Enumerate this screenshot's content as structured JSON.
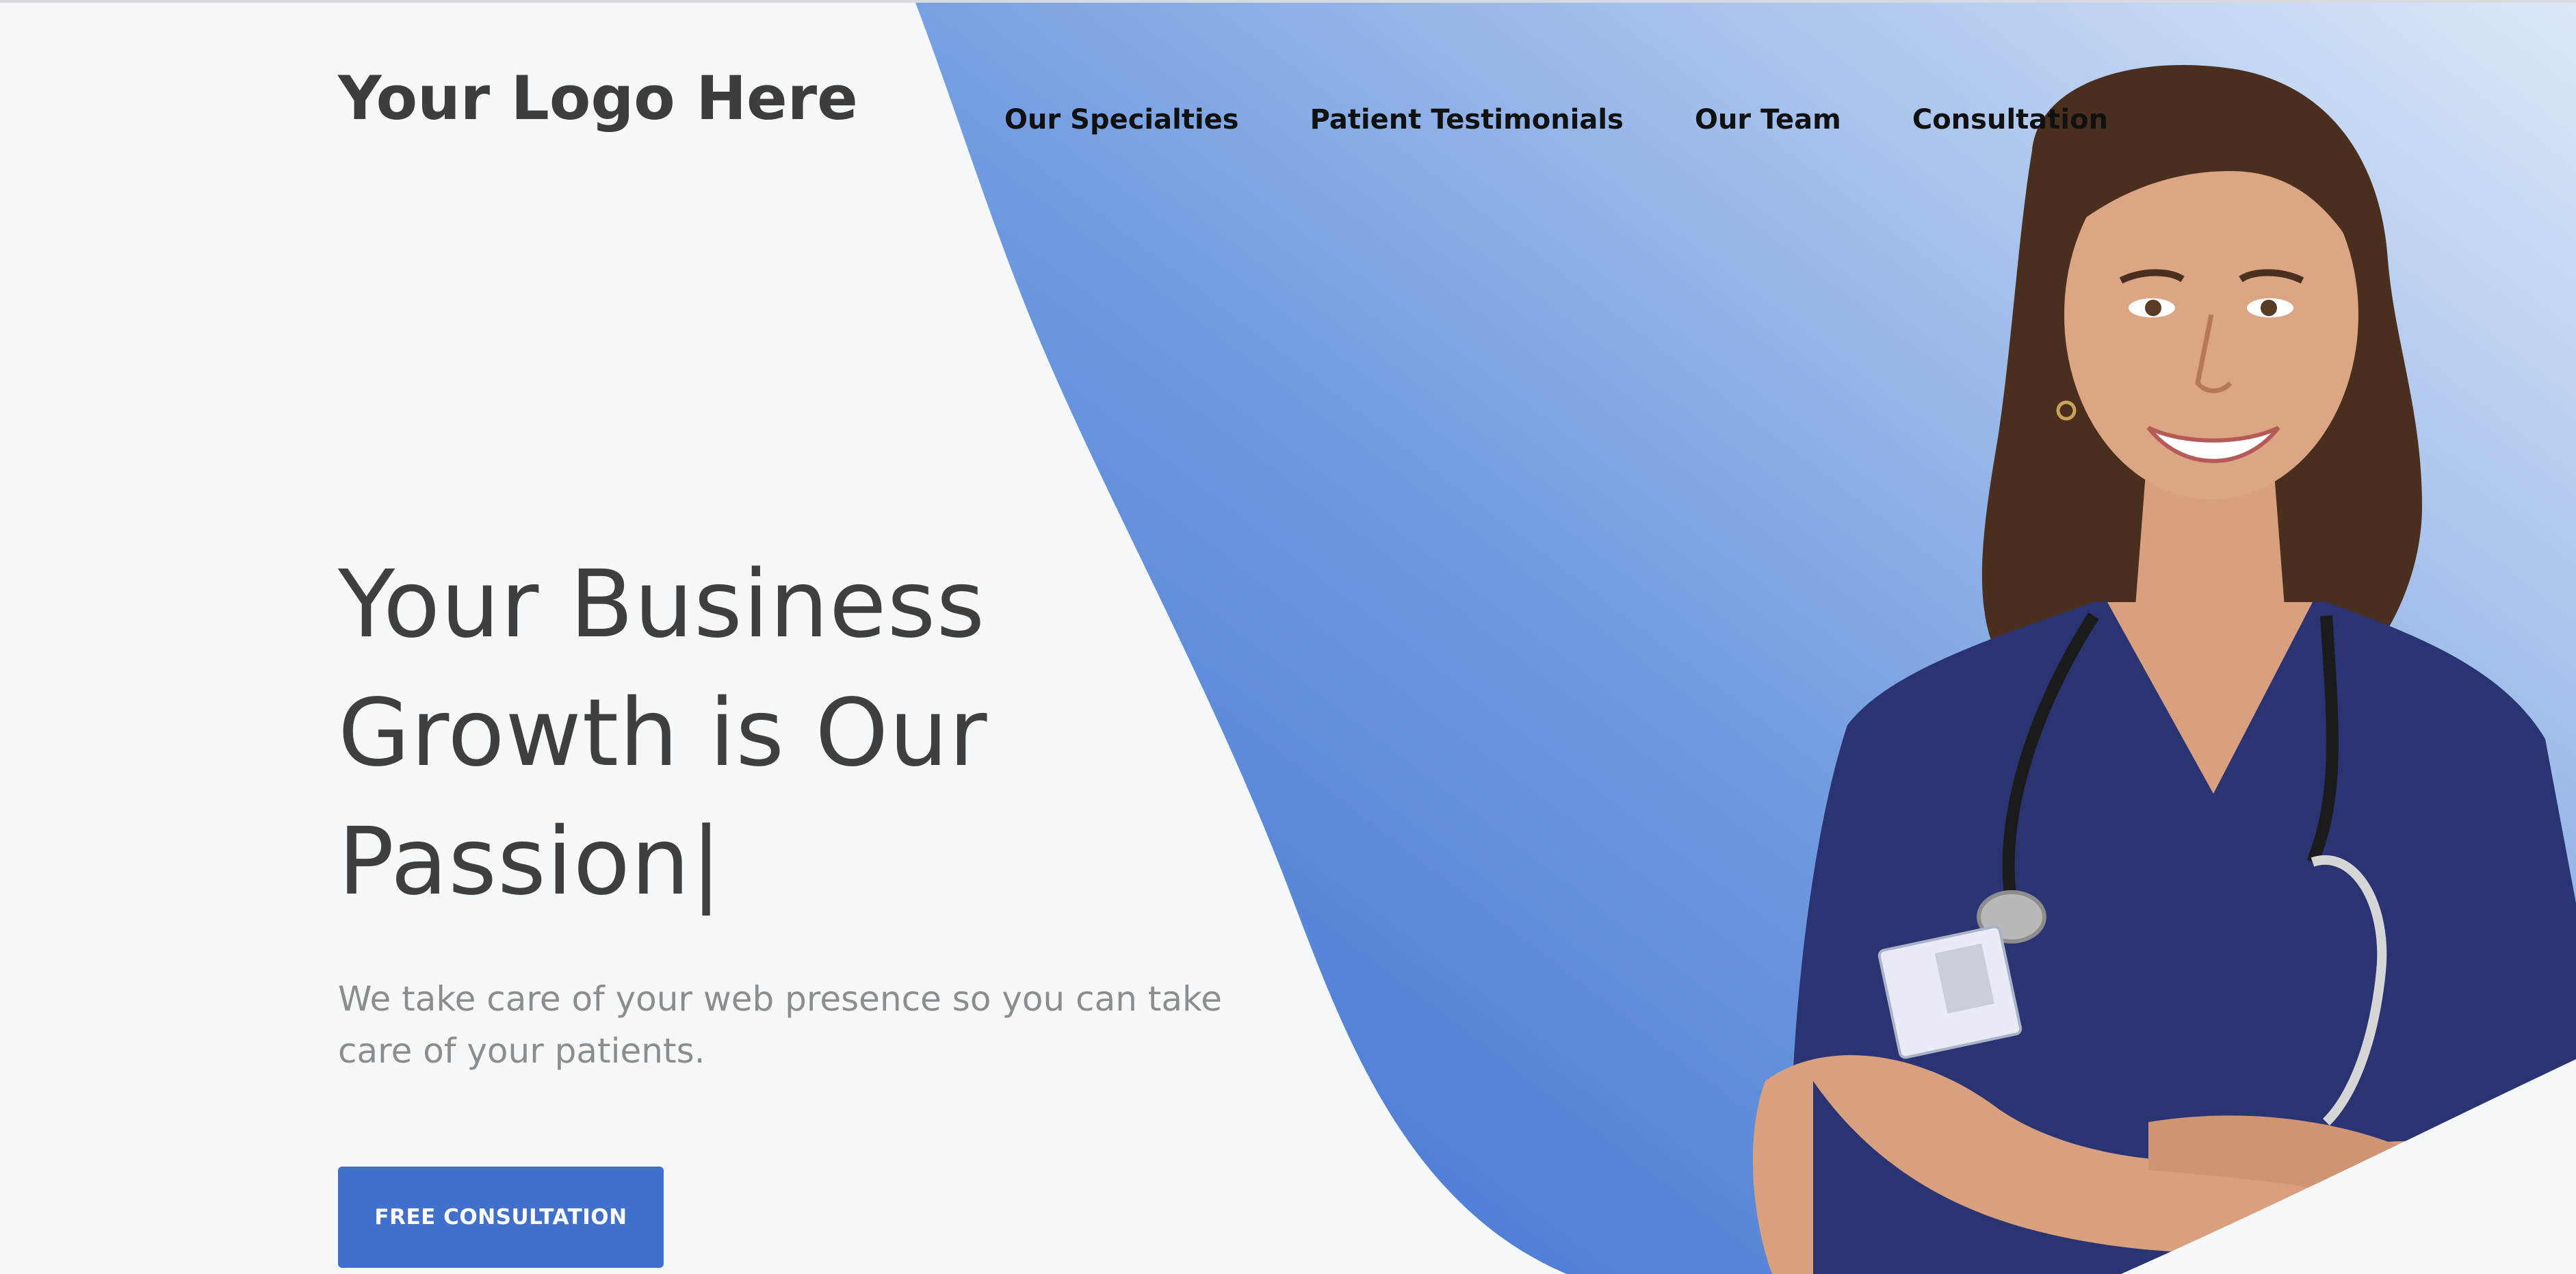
{
  "header": {
    "logo_text": "Your Logo Here",
    "nav": [
      {
        "label": "Our Specialties"
      },
      {
        "label": "Patient Testimonials"
      },
      {
        "label": "Our Team"
      },
      {
        "label": "Consultation"
      }
    ]
  },
  "hero": {
    "headline_lines": [
      "Your Business",
      "Growth is Our",
      "Passion"
    ],
    "caret": "|",
    "subtext": "We take care of your web presence so you can take care of your patients.",
    "cta_label": "FREE CONSULTATION"
  },
  "colors": {
    "accent": "#4070cc",
    "blue_light": "#b8d0f0",
    "blue_dark": "#3f6fcf",
    "background": "#f6f9fc",
    "scrubs": "#2a3472"
  },
  "icons": {
    "hero_image": "doctor-photo"
  }
}
